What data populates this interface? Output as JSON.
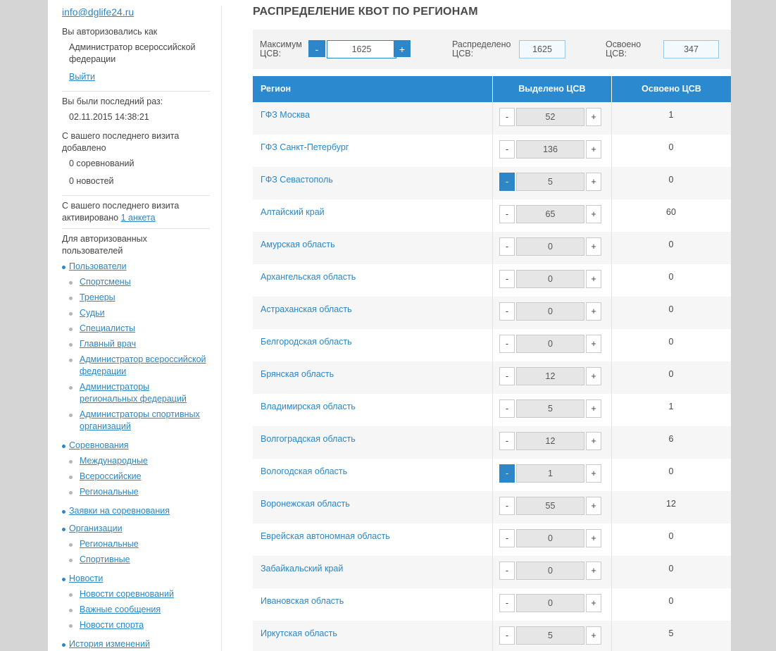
{
  "sidebar": {
    "email": "info@dglife24.ru",
    "logged_as_label": "Вы авторизовались как",
    "role_line1": "Администратор всероссийской",
    "role_line2": "федерации",
    "logout": "Выйти",
    "last_visit_label": "Вы были последний раз:",
    "last_visit_value": "02.11.2015 14:38:21",
    "added_line1": "С вашего последнего визита",
    "added_line2": "добавлено",
    "added_competitions": "0 соревнований",
    "added_news": "0 новостей",
    "activated_line1": "С вашего последнего визита",
    "activated_line2_prefix": "активировано",
    "activated_link": "1 анкета",
    "auth_line1": "Для авторизованных",
    "auth_line2": "пользователей",
    "nav": {
      "users": "Пользователи",
      "users_items": [
        "Спортсмены",
        "Тренеры",
        "Судьи",
        "Специалисты",
        "Главный врач"
      ],
      "users_admin_fed": [
        "Администратор всероссийской",
        "федерации"
      ],
      "users_admin_reg": [
        "Администраторы",
        "региональных федераций"
      ],
      "users_admin_org": [
        "Администраторы спортивных",
        "организаций"
      ],
      "competitions": "Соревнования",
      "competitions_items": [
        "Международные",
        "Всероссийские",
        "Региональные"
      ],
      "applications": "Заявки на соревнования",
      "organizations": "Организации",
      "organizations_items": [
        "Региональные",
        "Спортивные"
      ],
      "news": "Новости",
      "news_items": [
        "Новости соревнований",
        "Важные сообщения",
        "Новости спорта"
      ],
      "history": "История изменений"
    }
  },
  "main": {
    "title": "РАСПРЕДЕЛЕНИЕ КВОТ ПО РЕГИОНАМ",
    "controls": {
      "max_label1": "Максимум",
      "max_label2": "ЦСВ:",
      "max_value": "1625",
      "minus": "-",
      "plus": "+",
      "distributed_label1": "Распределено",
      "distributed_label2": "ЦСВ:",
      "distributed_value": "1625",
      "used_label1": "Освоено",
      "used_label2": "ЦСВ:",
      "used_value": "347"
    },
    "table": {
      "headers": [
        "Регион",
        "Выделено ЦСВ",
        "Освоено ЦСВ"
      ],
      "rows": [
        {
          "region": "ГФЗ Москва",
          "allocated": "52",
          "used": "1",
          "active_minus": false
        },
        {
          "region": "ГФЗ Санкт-Петербург",
          "allocated": "136",
          "used": "0",
          "active_minus": false
        },
        {
          "region": "ГФЗ Севастополь",
          "allocated": "5",
          "used": "0",
          "active_minus": true
        },
        {
          "region": "Алтайский край",
          "allocated": "65",
          "used": "60",
          "active_minus": false
        },
        {
          "region": "Амурская область",
          "allocated": "0",
          "used": "0",
          "active_minus": false
        },
        {
          "region": "Архангельская область",
          "allocated": "0",
          "used": "0",
          "active_minus": false
        },
        {
          "region": "Астраханская область",
          "allocated": "0",
          "used": "0",
          "active_minus": false
        },
        {
          "region": "Белгородская область",
          "allocated": "0",
          "used": "0",
          "active_minus": false
        },
        {
          "region": "Брянская область",
          "allocated": "12",
          "used": "0",
          "active_minus": false
        },
        {
          "region": "Владимирская область",
          "allocated": "5",
          "used": "1",
          "active_minus": false
        },
        {
          "region": "Волгоградская область",
          "allocated": "12",
          "used": "6",
          "active_minus": false
        },
        {
          "region": "Вологодская область",
          "allocated": "1",
          "used": "0",
          "active_minus": true
        },
        {
          "region": "Воронежская область",
          "allocated": "55",
          "used": "12",
          "active_minus": false
        },
        {
          "region": "Еврейская автономная область",
          "allocated": "0",
          "used": "0",
          "active_minus": false
        },
        {
          "region": "Забайкальский край",
          "allocated": "0",
          "used": "0",
          "active_minus": false
        },
        {
          "region": "Ивановская область",
          "allocated": "0",
          "used": "0",
          "active_minus": false
        },
        {
          "region": "Иркутская область",
          "allocated": "5",
          "used": "5",
          "active_minus": false
        }
      ],
      "minus_label": "-",
      "plus_label": "+"
    }
  }
}
